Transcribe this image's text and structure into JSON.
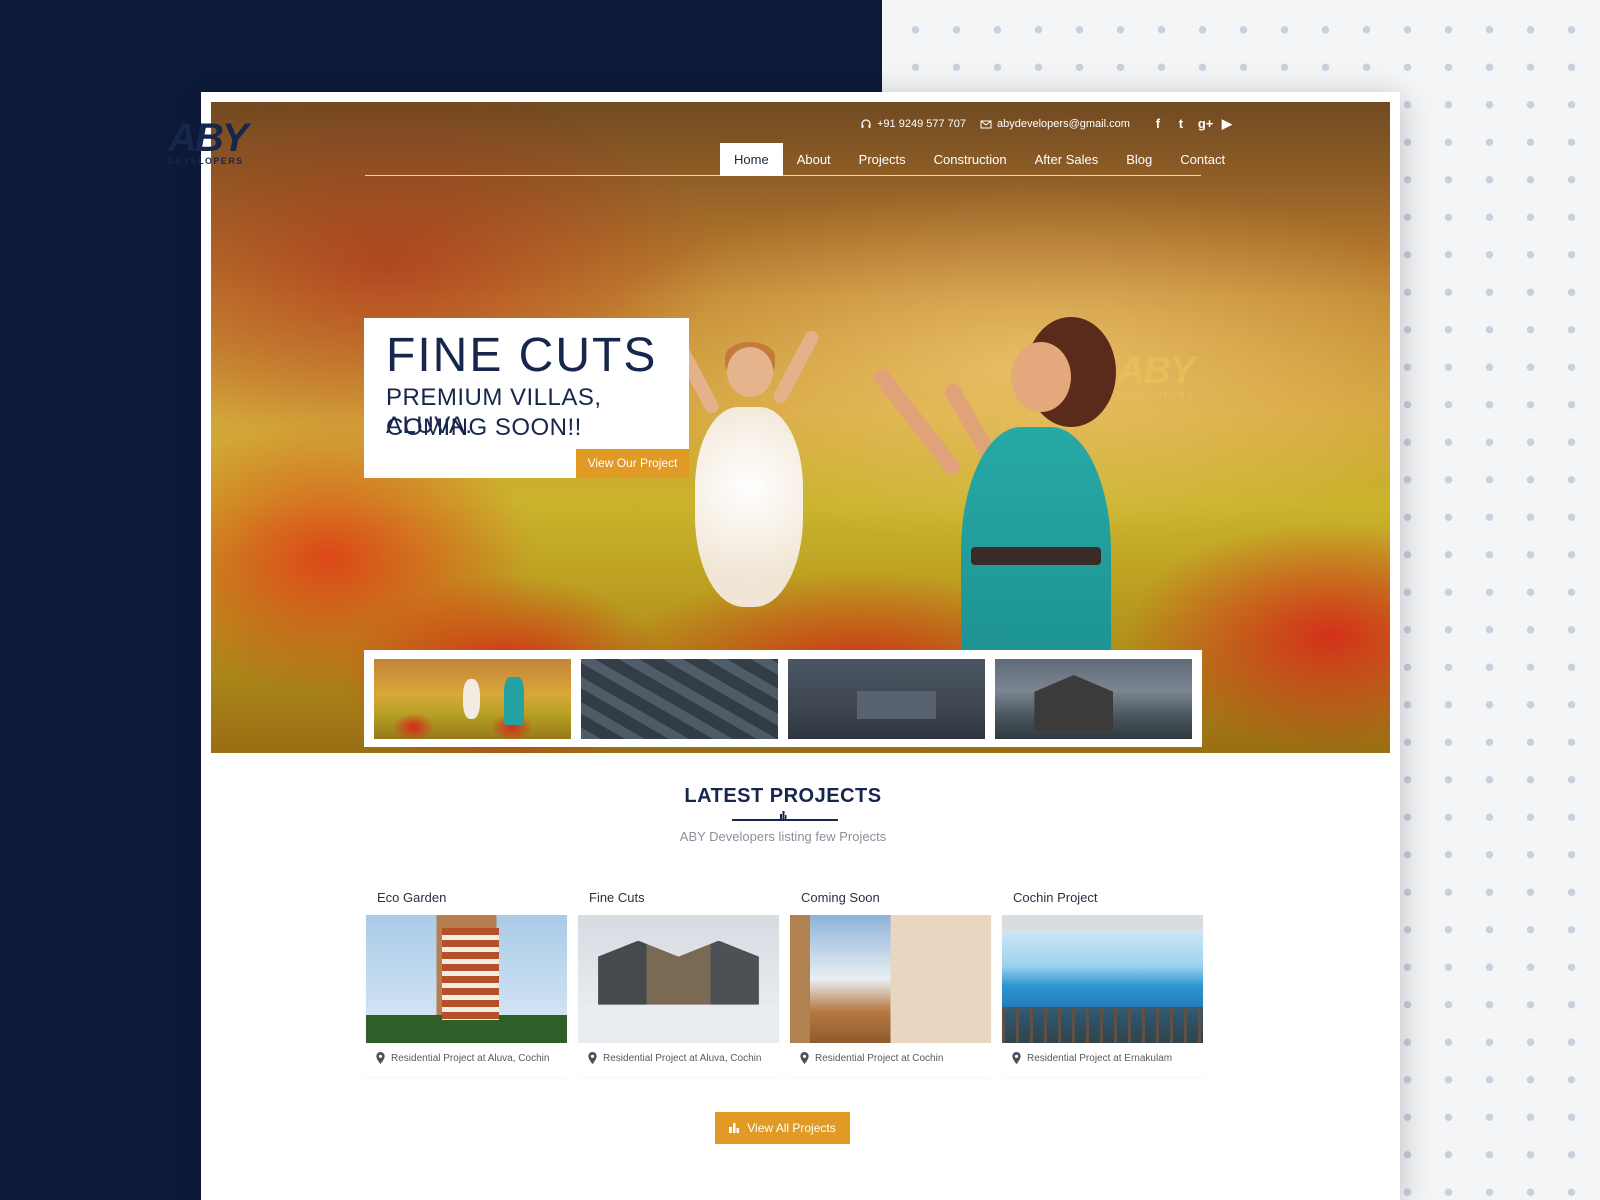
{
  "brand": {
    "logo_text": "ABY",
    "logo_sub": "DEVELOPERS"
  },
  "topbar": {
    "phone": "+91 9249 577 707",
    "email": "abydevelopers@gmail.com",
    "social": [
      "facebook-icon",
      "twitter-icon",
      "google-plus-icon",
      "youtube-icon"
    ],
    "social_glyphs": [
      "f",
      "t",
      "g+",
      "▶"
    ]
  },
  "nav": {
    "items": [
      {
        "label": "Home",
        "active": true
      },
      {
        "label": "About"
      },
      {
        "label": "Projects"
      },
      {
        "label": "Construction"
      },
      {
        "label": "After Sales"
      },
      {
        "label": "Blog"
      },
      {
        "label": "Contact"
      }
    ]
  },
  "hero": {
    "title": "FINE CUTS",
    "subtitle_1": "PREMIUM VILLAS, ALUVA.",
    "subtitle_2": "COMING SOON!!",
    "button": "View Our Project",
    "watermark_big": "ABY",
    "watermark_small": "DEVELOPERS"
  },
  "thumbnails": [
    "hero-family",
    "aerial-villas",
    "interior-bedroom",
    "villa-exterior"
  ],
  "latest": {
    "title": "LATEST PROJECTS",
    "subtitle": "ABY Developers listing few Projects",
    "cards": [
      {
        "title": "Eco Garden",
        "location": "Residential Project at Aluva, Cochin"
      },
      {
        "title": "Fine Cuts",
        "location": "Residential Project at Aluva, Cochin"
      },
      {
        "title": "Coming Soon",
        "location": "Residential Project at Cochin"
      },
      {
        "title": "Cochin Project",
        "location": "Residential Project at Ernakulam"
      }
    ],
    "view_all": "View All Projects"
  },
  "colors": {
    "navy": "#16264d",
    "accent": "#e09a25",
    "backdrop_dark": "#0d1a38"
  }
}
